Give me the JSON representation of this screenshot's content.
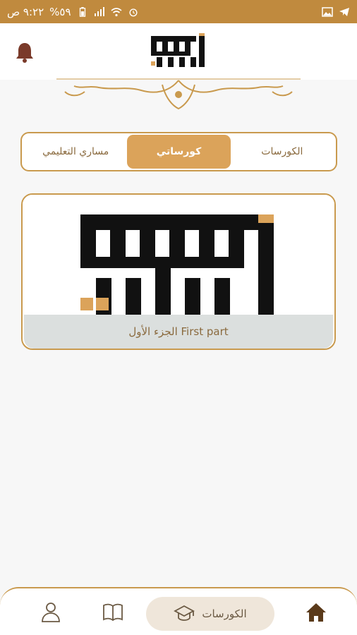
{
  "status_bar": {
    "time": "٩:٢٢ ص",
    "battery": "%٥٩",
    "colors": {
      "background": "#c08a3e"
    }
  },
  "header": {
    "logo_text": "أحمد الجيوشي",
    "icons": {
      "notifications": "bell-icon"
    }
  },
  "tabs": [
    {
      "label": "الكورسات",
      "active": false
    },
    {
      "label": "كورساتي",
      "active": true
    },
    {
      "label": "مساري التعليمي",
      "active": false
    }
  ],
  "course_card": {
    "title": "الجزء الأول First part"
  },
  "bottom_nav": {
    "items": [
      {
        "icon": "home-icon"
      },
      {
        "icon": "graduation-cap-icon",
        "label": "الكورسات",
        "active": true
      },
      {
        "icon": "book-icon"
      },
      {
        "icon": "user-icon"
      }
    ]
  },
  "colors": {
    "accent": "#c99a4e",
    "active_tab": "#dba35a",
    "text_brown": "#8a6a3e",
    "dark_brown": "#5a3a1a"
  }
}
